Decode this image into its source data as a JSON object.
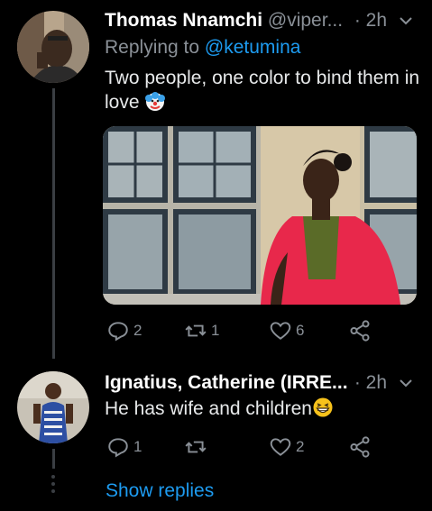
{
  "tweets": [
    {
      "name": "Thomas Nnamchi",
      "handle": "@viper...",
      "time": "· 2h",
      "reply_prefix": "Replying to ",
      "reply_mention": "@ketumina",
      "text": "Two people, one color to bind them in love",
      "emoji": "clown-face",
      "actions": {
        "replies": "2",
        "retweets": "1",
        "likes": "6"
      }
    },
    {
      "name": "Ignatius, Catherine (IRRE...",
      "time": "· 2h",
      "text": "He has wife and children",
      "emoji": "grinning-squinting-face",
      "actions": {
        "replies": "1",
        "retweets": "",
        "likes": "2"
      }
    }
  ],
  "show_replies": "Show replies",
  "colors": {
    "background": "#000000",
    "link": "#1d9bf0",
    "muted": "#8a9097",
    "jacket": "#e8284b"
  }
}
